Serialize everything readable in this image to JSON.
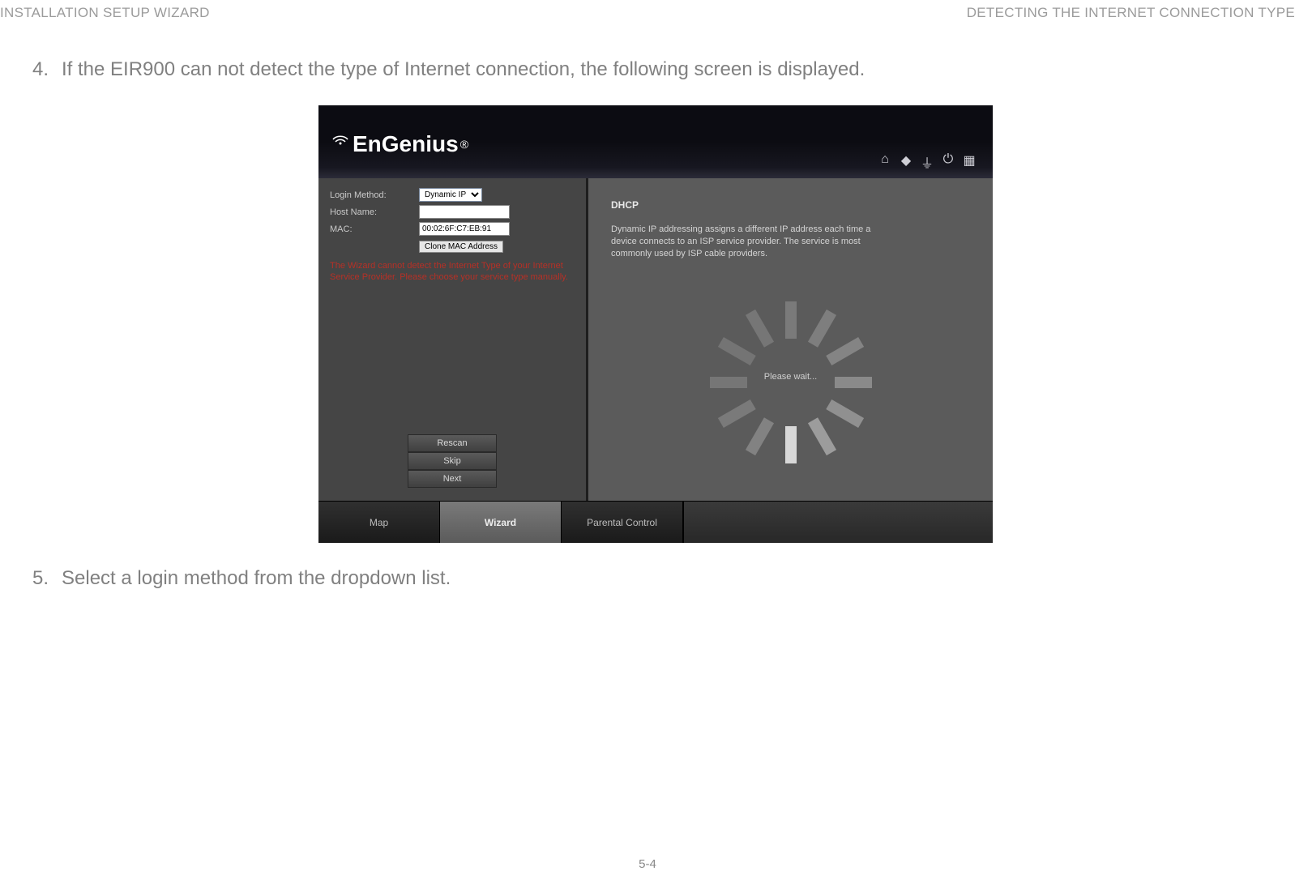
{
  "header": {
    "left": "INSTALLATION SETUP WIZARD",
    "right": "DETECTING THE INTERNET CONNECTION TYPE"
  },
  "steps": {
    "s4": {
      "num": "4.",
      "text": "If the EIR900 can not detect the type of Internet connection, the following screen is displayed."
    },
    "s5": {
      "num": "5.",
      "text": "Select a login method from the dropdown list."
    }
  },
  "screenshot": {
    "brand": "EnGenius",
    "brand_reg": "®",
    "left": {
      "login_label": "Login Method:",
      "login_value": "Dynamic IP",
      "host_label": "Host Name:",
      "host_value": "",
      "mac_label": "MAC:",
      "mac_value": "00:02:6F:C7:EB:91",
      "clone_btn": "Clone MAC Address",
      "warning": "The Wizard cannot detect the Internet Type of your Internet Service Provider. Please choose your service type manually.",
      "rescan": "Rescan",
      "skip": "Skip",
      "next": "Next"
    },
    "right": {
      "title": "DHCP",
      "body": "Dynamic IP addressing assigns a different IP address each time a device connects to an ISP service provider. The service is most commonly used by ISP cable providers.",
      "wait": "Please wait..."
    },
    "tabs": {
      "map": "Map",
      "wizard": "Wizard",
      "parental": "Parental Control"
    },
    "icons": {
      "home": "home-icon",
      "network": "network-icon",
      "antenna": "antenna-icon",
      "power": "power-icon",
      "lang": "language-icon"
    }
  },
  "page_number": "5-4"
}
